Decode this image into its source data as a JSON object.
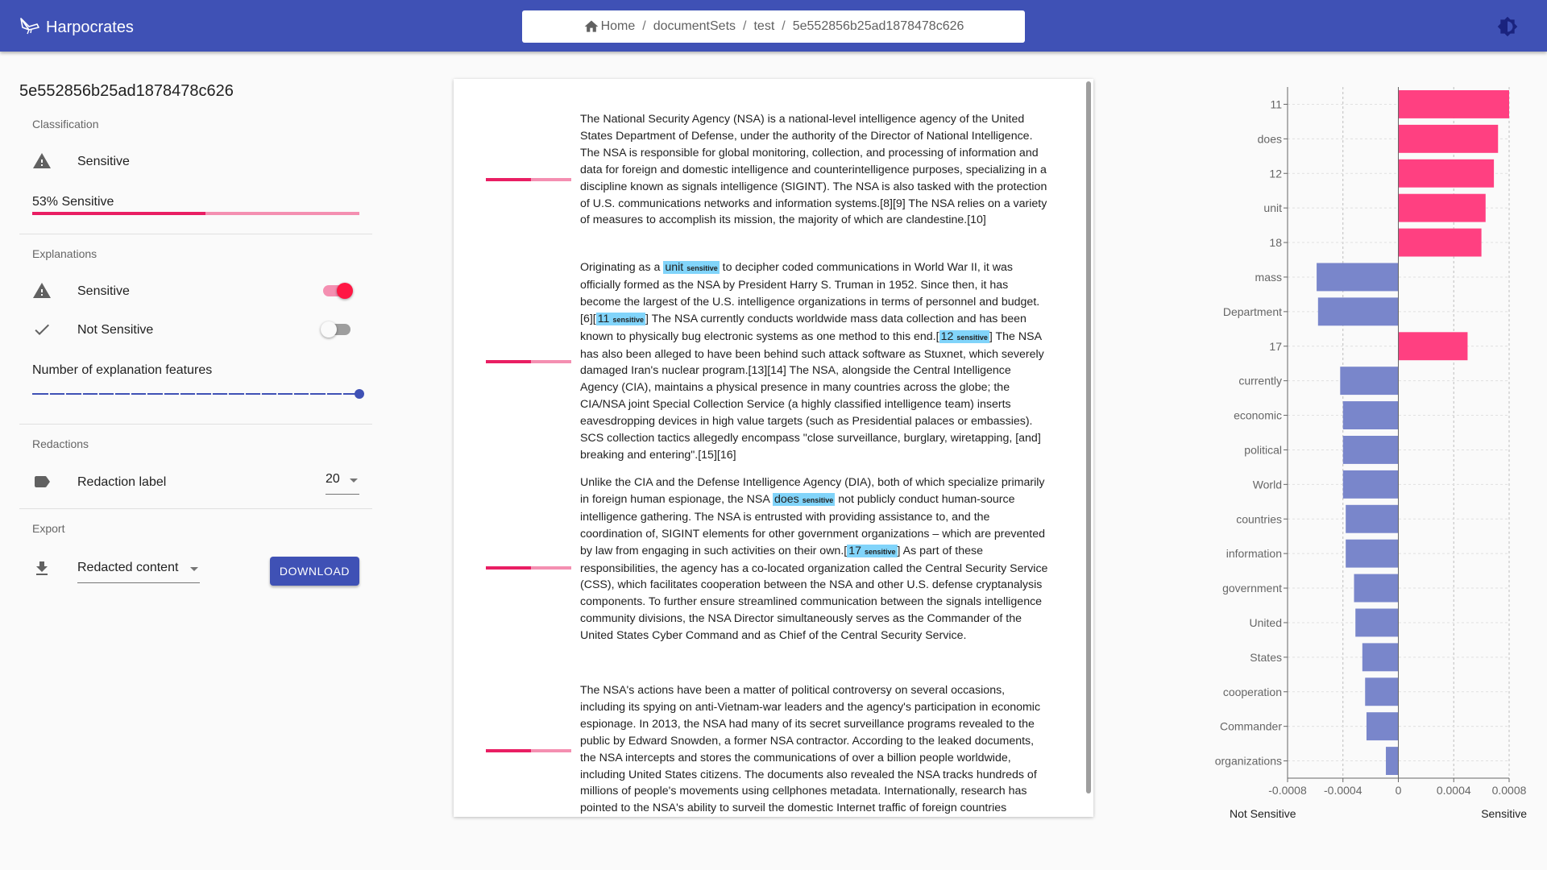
{
  "app": {
    "title": "Harpocrates",
    "logo_icon": "bird-logo-icon",
    "theme_icon": "brightness-icon"
  },
  "breadcrumb": {
    "items": [
      "Home",
      "documentSets",
      "test",
      "5e552856b25ad1878478c626"
    ],
    "separator": "/"
  },
  "sidebar": {
    "doc_id": "5e552856b25ad1878478c626",
    "classification": {
      "title": "Classification",
      "label": "Sensitive",
      "icon": "warning-icon",
      "percent_text": "53% Sensitive",
      "percent": 53
    },
    "explanations": {
      "title": "Explanations",
      "sensitive_label": "Sensitive",
      "sensitive_on": true,
      "not_sensitive_label": "Not Sensitive",
      "not_sensitive_on": false,
      "features_label": "Number of explanation features",
      "features_fraction": 1.0
    },
    "redactions": {
      "title": "Redactions",
      "label": "Redaction label",
      "value": "20"
    },
    "export": {
      "title": "Export",
      "option": "Redacted content",
      "button": "DOWNLOAD"
    }
  },
  "document": {
    "tag": "sensitive",
    "paragraphs": [
      {
        "sensitivity_fraction": 0.53,
        "segments": [
          {
            "t": "The National Security Agency (NSA) is a national-level intelligence agency of the United States Department of Defense, under the authority of the Director of National Intelligence. The NSA is responsible for global monitoring, collection, and processing of information and data for foreign and domestic intelligence and counterintelligence purposes, specializing in a discipline known as signals intelligence (SIGINT). The NSA is also tasked with the protection of U.S. communications networks and information systems.[8][9] The NSA relies on a variety of measures to accomplish its mission, the majority of which are clandestine.[10]"
          }
        ]
      },
      {
        "sensitivity_fraction": 0.53,
        "segments": [
          {
            "t": "Originating as a "
          },
          {
            "h": "unit"
          },
          {
            "t": " to decipher coded communications in World War II, it was officially formed as the NSA by President Harry S. Truman in 1952. Since then, it has become the largest of the U.S. intelligence organizations in terms of personnel and budget.[6]["
          },
          {
            "h": "11"
          },
          {
            "t": "] The NSA currently conducts worldwide mass data collection and has been known to physically bug electronic systems as one method to this end.["
          },
          {
            "h": "12"
          },
          {
            "t": "] The NSA has also been alleged to have been behind such attack software as Stuxnet, which severely damaged Iran's nuclear program.[13][14] The NSA, alongside the Central Intelligence Agency (CIA), maintains a physical presence in many countries across the globe; the CIA/NSA joint Special Collection Service (a highly classified intelligence team) inserts eavesdropping devices in high value targets (such as Presidential palaces or embassies). SCS collection tactics allegedly encompass \"close surveillance, burglary, wiretapping, [and] breaking and entering\".[15][16]"
          }
        ]
      },
      {
        "sensitivity_fraction": 0.53,
        "segments": [
          {
            "t": "Unlike the CIA and the Defense Intelligence Agency (DIA), both of which specialize primarily in foreign human espionage, the NSA "
          },
          {
            "h": "does"
          },
          {
            "t": " not publicly conduct human-source intelligence gathering. The NSA is entrusted with providing assistance to, and the coordination of, SIGINT elements for other government organizations – which are prevented by law from engaging in such activities on their own.["
          },
          {
            "h": "17"
          },
          {
            "t": "] As part of these responsibilities, the agency has a co-located organization called the Central Security Service (CSS), which facilitates cooperation between the NSA and other U.S. defense cryptanalysis components. To further ensure streamlined communication between the signals intelligence community divisions, the NSA Director simultaneously serves as the Commander of the United States Cyber Command and as Chief of the Central Security Service."
          }
        ]
      },
      {
        "sensitivity_fraction": 0.53,
        "segments": [
          {
            "t": "The NSA's actions have been a matter of political controversy on several occasions, including its spying on anti-Vietnam-war leaders and the agency's participation in economic espionage. In 2013, the NSA had many of its secret surveillance programs revealed to the public by Edward Snowden, a former NSA contractor. According to the leaked documents, the NSA intercepts and stores the communications of over a billion people worldwide, including United States citizens. The documents also revealed the NSA tracks hundreds of millions of people's movements using cellphones metadata. Internationally, research has pointed to the NSA's ability to surveil the domestic Internet traffic of foreign countries"
          }
        ]
      }
    ]
  },
  "chart_data": {
    "type": "bar",
    "orientation": "horizontal",
    "categories": [
      "11",
      "does",
      "12",
      "unit",
      "18",
      "mass",
      "Department",
      "17",
      "currently",
      "economic",
      "political",
      "World",
      "countries",
      "information",
      "government",
      "United",
      "States",
      "cooperation",
      "Commander",
      "organizations"
    ],
    "values": [
      0.0008,
      0.00072,
      0.00069,
      0.00063,
      0.0006,
      -0.00059,
      -0.00058,
      0.0005,
      -0.00042,
      -0.0004,
      -0.0004,
      -0.0004,
      -0.00038,
      -0.00038,
      -0.00032,
      -0.00031,
      -0.00026,
      -0.00024,
      -0.00023,
      -9e-05
    ],
    "xlim": [
      -0.0008,
      0.0008
    ],
    "xticks": [
      "-0.0008",
      "-0.0004",
      "0",
      "0.0004",
      "0.0008"
    ],
    "xtick_values": [
      -0.0008,
      -0.0004,
      0,
      0.0004,
      0.0008
    ],
    "left_label": "Not Sensitive",
    "right_label": "Sensitive",
    "colors": {
      "positive": "#ff4081",
      "negative": "#7986cb"
    },
    "grid": true
  }
}
